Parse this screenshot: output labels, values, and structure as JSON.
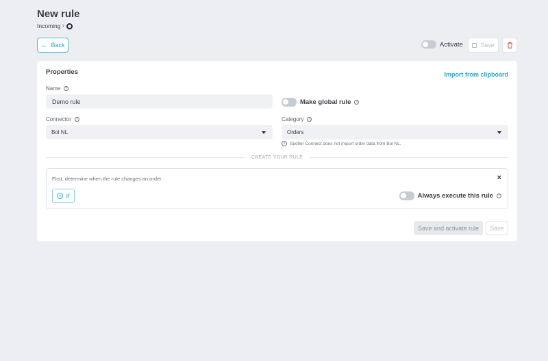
{
  "header": {
    "title": "New rule",
    "breadcrumb": "Incoming"
  },
  "toolbar": {
    "back_label": "Back",
    "activate_label": "Activate",
    "activate_on": false,
    "save_label": "Save",
    "delete_icon": "trash-icon"
  },
  "properties": {
    "title": "Properties",
    "import_label": "Import from clipboard",
    "name_label": "Name",
    "name_value": "Demo rule",
    "global_label": "Make global rule",
    "global_on": false,
    "connector_label": "Connector",
    "connector_value": "Bol NL",
    "category_label": "Category",
    "category_value": "Orders",
    "category_note": "Spotler Connect does not import order data from Bol NL."
  },
  "rule": {
    "divider_text": "CREATE YOUR RULE",
    "description": "First, determine when the rule changes an order.",
    "if_label": "If",
    "always_label": "Always execute this rule",
    "always_on": false
  },
  "footer": {
    "save_activate_label": "Save and activate rule",
    "save_label": "Save"
  },
  "colors": {
    "accent": "#2aa7c8",
    "background": "#eceef2",
    "danger": "#e0533d"
  }
}
